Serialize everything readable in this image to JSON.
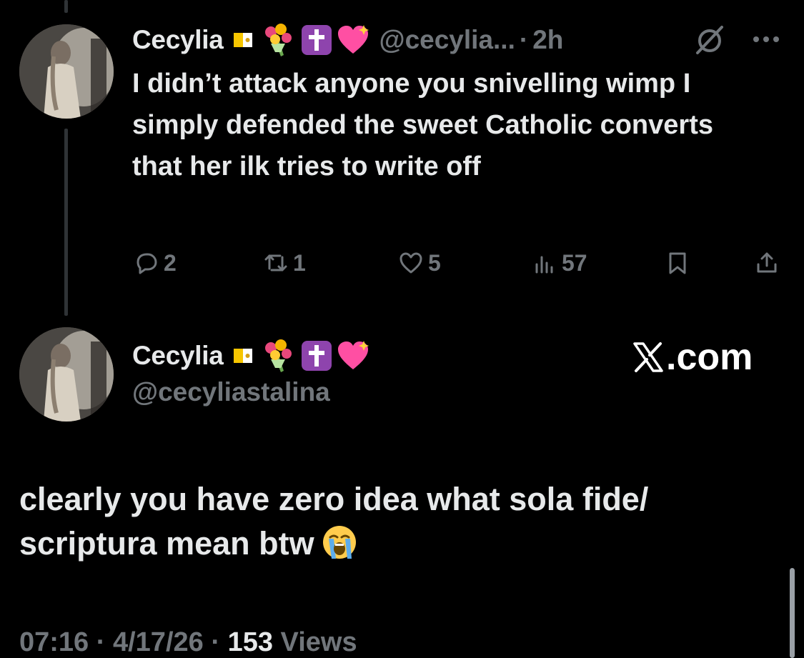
{
  "parent_tweet": {
    "display_name": "Cecylia",
    "handle": "@cecylia...",
    "separator": "·",
    "time": "2h",
    "text": "I didn’t attack anyone you snivelling wimp I simply defended the sweet Catholic converts that her ilk tries to write off",
    "actions": {
      "replies": "2",
      "reposts": "1",
      "likes": "5",
      "views": "57"
    },
    "icons": [
      "vatican-flag-emoji",
      "bouquet-emoji",
      "latin-cross-emoji",
      "sparkling-heart-emoji",
      "grok-icon",
      "more-icon",
      "reply-icon",
      "retweet-icon",
      "like-icon",
      "views-icon",
      "bookmark-icon",
      "share-icon"
    ]
  },
  "main_tweet": {
    "display_name": "Cecylia",
    "handle": "@cecyliastalina",
    "watermark": ".com",
    "text": "clearly you have zero idea what sola fide/ scriptura mean btw",
    "emoji": "loudly-crying-face-emoji",
    "time": "07:16",
    "date": "4/17/26",
    "separator": "·",
    "views_count": "153",
    "views_label": "Views"
  },
  "colors": {
    "background": "#000000",
    "text_primary": "#e7e9ea",
    "text_secondary": "#71767b",
    "cross_purple": "#8e44ad",
    "heart_pink": "#ff4fa3"
  }
}
